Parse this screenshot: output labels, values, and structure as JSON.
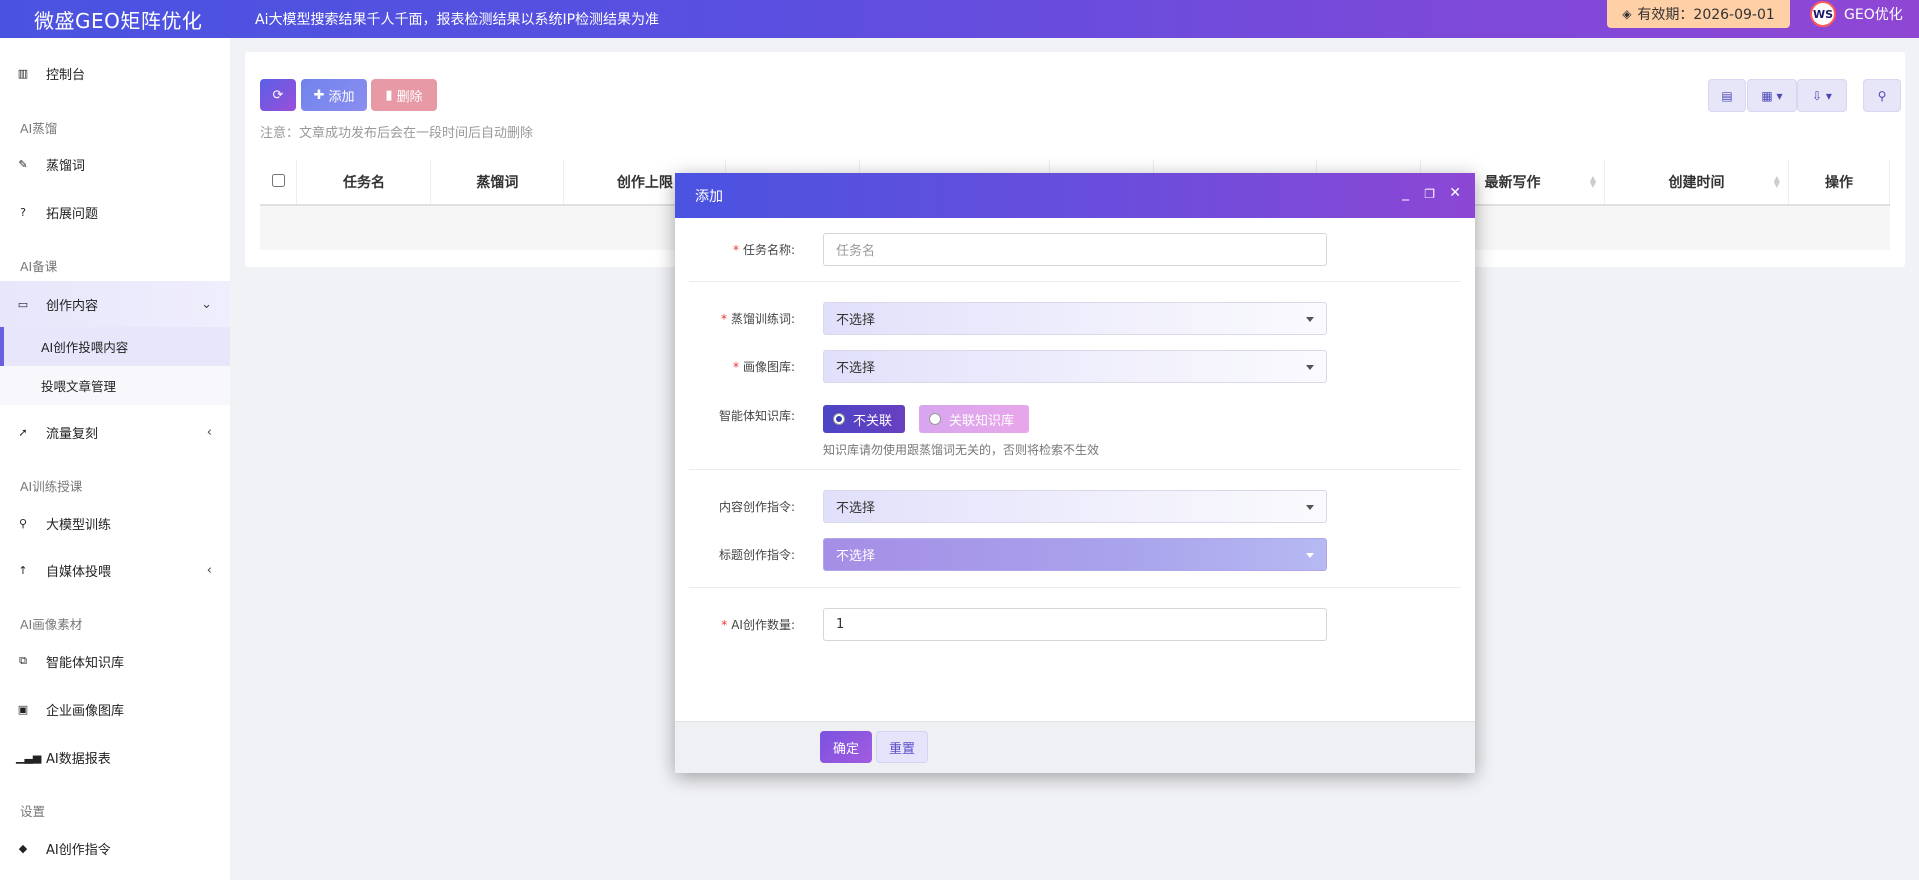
{
  "topbar": {
    "brand": "微盛GEO矩阵优化",
    "notice": "Ai大模型搜索结果千人千面，报表检测结果以系统IP检测结果为准",
    "validity": "有效期：2026-09-01",
    "avatar_text": "WS",
    "username": "GEO优化"
  },
  "sidebar": {
    "dashboard": "控制台",
    "group_distill": "AI蒸馏",
    "distill_words": "蒸馏词",
    "expand_questions": "拓展问题",
    "group_prepare": "AI备课",
    "create_content": "创作内容",
    "sub_ai_create": "AI创作投喂内容",
    "sub_article_mgmt": "投喂文章管理",
    "traffic_copy": "流量复刻",
    "group_training": "AI训练授课",
    "llm_training": "大模型训练",
    "self_media": "自媒体投喂",
    "group_assets": "AI画像素材",
    "agent_kb": "智能体知识库",
    "enterprise_gallery": "企业画像图库",
    "ai_report": "AI数据报表",
    "group_settings": "设置",
    "ai_commands": "AI创作指令"
  },
  "toolbar": {
    "add_label": "添加",
    "delete_label": "删除",
    "note": "注意：文章成功发布后会在一段时间后自动删除"
  },
  "table": {
    "columns": [
      "任务名",
      "蒸馏词",
      "创作上限",
      "",
      "",
      "",
      "",
      "",
      "最新写作",
      "创建时间",
      "操作"
    ]
  },
  "modal": {
    "title": "添加",
    "task_name_label": "任务名称:",
    "task_name_placeholder": "任务名",
    "distill_label": "蒸馏训练词:",
    "distill_value": "不选择",
    "gallery_label": "画像图库:",
    "gallery_value": "不选择",
    "kb_label": "智能体知识库:",
    "kb_opt_none": "不关联",
    "kb_opt_link": "关联知识库",
    "kb_hint": "知识库请勿使用跟蒸馏词无关的，否则将检索不生效",
    "content_cmd_label": "内容创作指令:",
    "content_cmd_value": "不选择",
    "title_cmd_label": "标题创作指令:",
    "title_cmd_value": "不选择",
    "count_label": "AI创作数量:",
    "count_value": "1",
    "confirm": "确定",
    "reset": "重置"
  },
  "colors": {
    "header_start": "#4a53e0",
    "header_end": "#8f47d3",
    "validity_bg": "#ffcfa6",
    "accent": "#6a5fe0"
  }
}
